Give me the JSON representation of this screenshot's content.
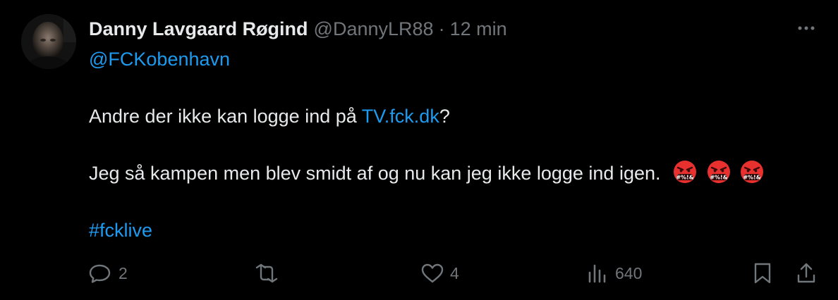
{
  "author": {
    "name": "Danny Lavgaard Røgind",
    "handle": "@DannyLR88",
    "separator": "·",
    "time": "12 min"
  },
  "tweet": {
    "reply_to": "@FCKobenhavn",
    "line1_prefix": "Andre der ikke kan logge ind på ",
    "line1_link": "TV.fck.dk",
    "line1_suffix": "?",
    "line2": "Jeg så kampen men blev smidt af og nu kan jeg ikke logge ind igen.",
    "emojis": [
      "face-with-symbols-on-mouth-icon",
      "face-with-symbols-on-mouth-icon",
      "face-with-symbols-on-mouth-icon"
    ],
    "hashtag": "#fcklive"
  },
  "actions": {
    "replies": "2",
    "reposts": "",
    "likes": "4",
    "views": "640"
  },
  "colors": {
    "background": "#000000",
    "text": "#e7e9ea",
    "muted": "#71767b",
    "link": "#1d9bf0",
    "emoji_red": "#e8312f"
  }
}
